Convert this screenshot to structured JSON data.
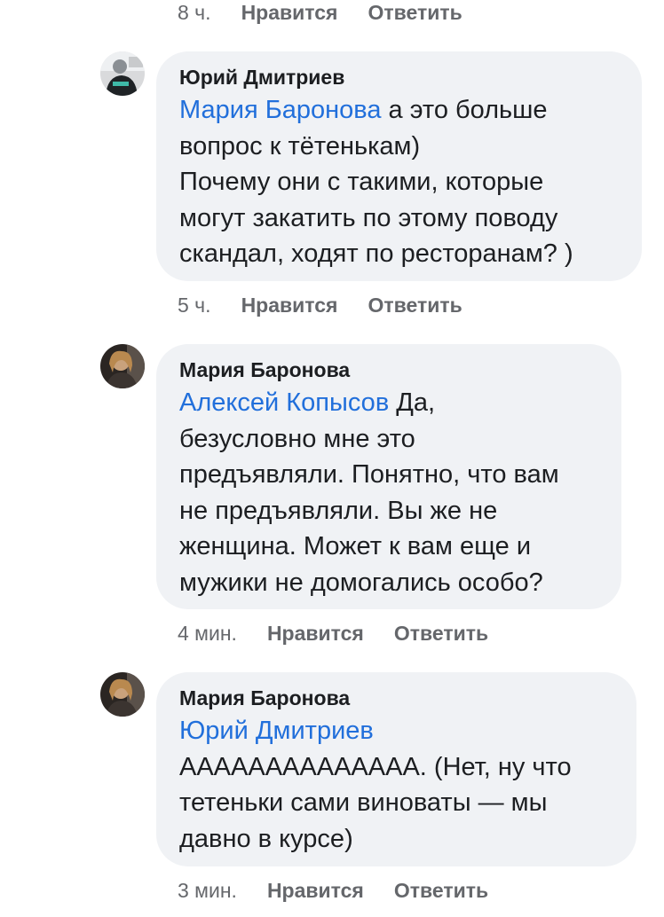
{
  "top_row": {
    "time": "8 ч.",
    "like": "Нравится",
    "reply": "Ответить"
  },
  "comments": [
    {
      "author": "Юрий Дмитриев",
      "mention": "Мария Баронова",
      "text": " а это больше\nвопрос к тётенькам)\nПочему они с такими, которые\nмогут закатить по этому поводу\nскандал, ходят по ресторанам? )",
      "time": "5 ч.",
      "like": "Нравится",
      "reply": "Ответить"
    },
    {
      "author": "Мария Баронова",
      "mention": "Алексей Копысов",
      "text": " Да,\nбезусловно мне это\nпредъявляли. Понятно, что вам\nне предъявляли. Вы же не\nженщина. Может к вам еще и\nмужики не домогались особо?",
      "time": "4 мин.",
      "like": "Нравится",
      "reply": "Ответить"
    },
    {
      "author": "Мария Баронова",
      "mention": "Юрий Дмитриев",
      "text": "\nАААААААААААААА. (Нет, ну что\nтетеньки сами виноваты — мы\nдавно в курсе)",
      "time": "3 мин.",
      "like": "Нравится",
      "reply": "Ответить"
    }
  ],
  "colors": {
    "bubble": "#f0f2f5",
    "mention": "#216fdb",
    "meta": "#65676b",
    "text": "#1c1e21"
  },
  "icons": {
    "avatar_1": "user-avatar-photo",
    "avatar_2": "user-avatar-photo",
    "avatar_3": "user-avatar-photo"
  }
}
